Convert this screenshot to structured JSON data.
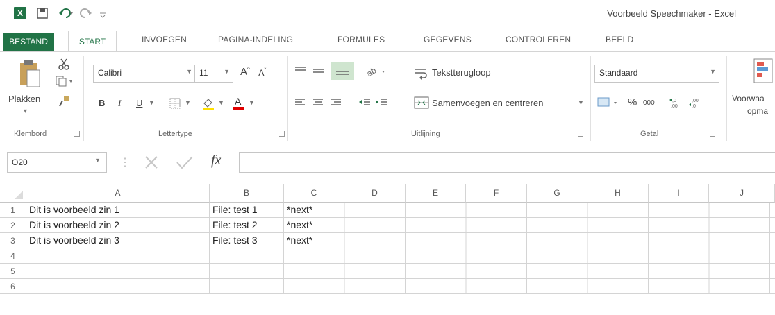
{
  "window": {
    "title": "Voorbeeld Speechmaker - Excel",
    "app_icon": "X"
  },
  "tabs": [
    "BESTAND",
    "START",
    "INVOEGEN",
    "PAGINA-INDELING",
    "FORMULES",
    "GEGEVENS",
    "CONTROLEREN",
    "BEELD"
  ],
  "ribbon": {
    "clipboard": {
      "paste_label": "Plakken",
      "group_label": "Klembord"
    },
    "font": {
      "font_name": "Calibri",
      "font_size": "11",
      "bold": "B",
      "italic": "I",
      "underline": "U",
      "group_label": "Lettertype"
    },
    "alignment": {
      "wrap_text": "Tekstterugloop",
      "merge_center": "Samenvoegen en centreren",
      "group_label": "Uitlijning"
    },
    "number": {
      "format": "Standaard",
      "percent": "%",
      "thousands": "000",
      "group_label": "Getal"
    },
    "conditional": {
      "label_line1": "Voorwaa",
      "label_line2": "opma"
    }
  },
  "formula_bar": {
    "name_box": "O20",
    "fx": "fx",
    "formula": ""
  },
  "sheet": {
    "columns": [
      "A",
      "B",
      "C",
      "D",
      "E",
      "F",
      "G",
      "H",
      "I",
      "J"
    ],
    "rows": [
      {
        "num": "1",
        "cells": [
          "Dit is voorbeeld zin 1",
          "File: test 1",
          "*next*"
        ]
      },
      {
        "num": "2",
        "cells": [
          "Dit is voorbeeld zin 2",
          "File: test 2",
          "*next*"
        ]
      },
      {
        "num": "3",
        "cells": [
          "Dit is voorbeeld zin 3",
          "File: test 3",
          "*next*"
        ]
      },
      {
        "num": "4",
        "cells": [
          "",
          "",
          ""
        ]
      },
      {
        "num": "5",
        "cells": [
          "",
          "",
          ""
        ]
      },
      {
        "num": "6",
        "cells": [
          "",
          "",
          ""
        ]
      }
    ]
  },
  "colors": {
    "accent": "#217346"
  }
}
